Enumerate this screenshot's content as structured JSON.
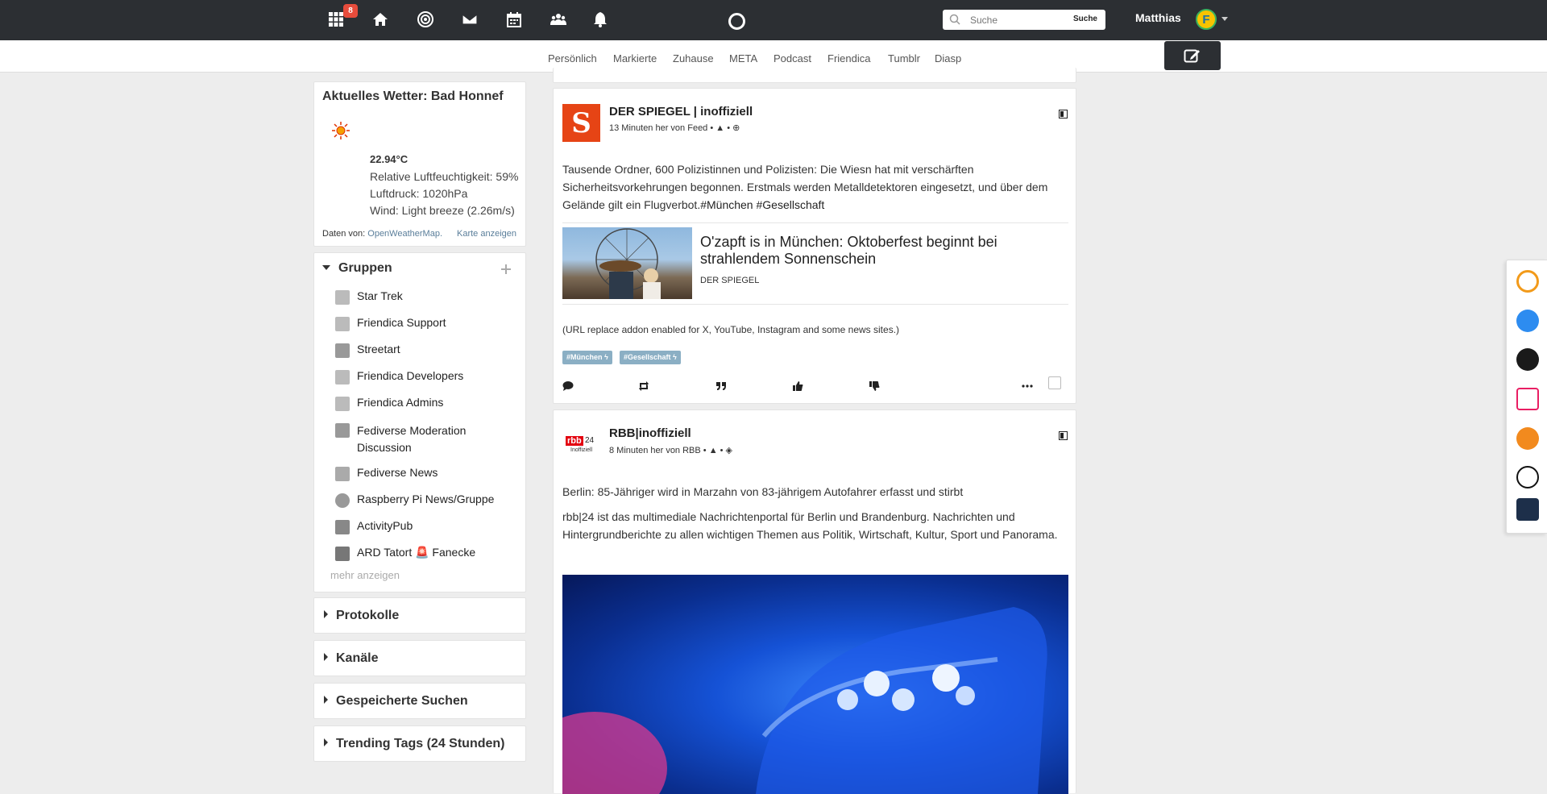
{
  "nav": {
    "notification_count": "8",
    "search_placeholder": "Suche",
    "search_button": "Suche",
    "user_name": "Matthias"
  },
  "tabs": [
    "Persönlich",
    "Markierte",
    "Zuhause",
    "META",
    "Podcast",
    "Friendica",
    "Tumblr",
    "Diasp"
  ],
  "active_tab": "Zuhause",
  "weather": {
    "title": "Aktuelles Wetter: Bad Honnef",
    "temp": "22.94°C",
    "humidity": "Relative Luftfeuchtigkeit: 59%",
    "pressure": "Luftdruck: 1020hPa",
    "wind": "Wind: Light breeze (2.26m/s)",
    "source_prefix": "Daten von:",
    "source_link": "OpenWeatherMap.",
    "map_link": "Karte anzeigen"
  },
  "groups": {
    "title": "Gruppen",
    "items": [
      "Star Trek",
      "Friendica Support",
      "Streetart",
      "Friendica Developers",
      "Friendica Admins",
      "Fediverse Moderation Discussion",
      "Fediverse News",
      "Raspberry Pi News/Gruppe",
      "ActivityPub",
      "ARD Tatort 🚨 Fanecke"
    ],
    "more": "mehr anzeigen"
  },
  "sections": [
    "Protokolle",
    "Kanäle",
    "Gespeicherte Suchen",
    "Trending Tags (24 Stunden)"
  ],
  "post1": {
    "author": "DER SPIEGEL | inoffiziell",
    "meta": "13 Minuten her von Feed",
    "body_plain": "Tausende Ordner, 600 Polizistinnen und Polizisten: Die Wiesn hat mit verschärften Sicherheitsvorkehrungen begonnen. Erstmals werden Metalldetektoren eingesetzt, und über dem Gelände gilt ein Flugverbot.",
    "body_tags": "#München #Gesellschaft",
    "card_title": "O'zapft is in München: Oktoberfest beginnt bei strahlendem Sonnenschein",
    "card_source": "DER SPIEGEL",
    "note": "(URL replace addon enabled for X, YouTube, Instagram and some news sites.)",
    "tag1": "#München ϟ",
    "tag2": "#Gesellschaft ϟ"
  },
  "post2": {
    "author": "RBB|inoffiziell",
    "meta": "8 Minuten her von RBB",
    "logo_text": "rbb",
    "logo_num": "24",
    "logo_sub": "Inoffiziell",
    "headline": "Berlin: 85-Jähriger wird in Marzahn von 83-jährigem Autofahrer erfasst und stirbt",
    "body": "rbb|24 ist das multimediale Nachrichtenportal für Berlin und Brandenburg. Nachrichten und Hintergrundberichte zu allen wichtigen Themen aus Politik, Wirtschaft, Kultur, Sport und Panorama."
  }
}
